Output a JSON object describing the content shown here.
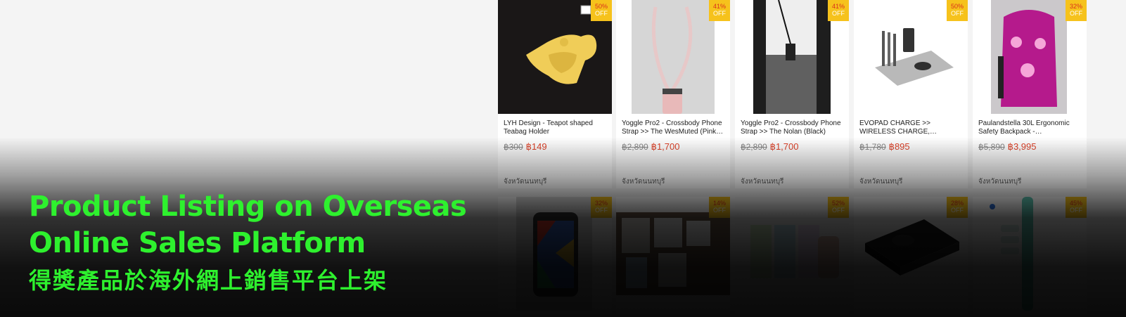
{
  "banner": {
    "headline_line1": "Product Listing on Overseas",
    "headline_line2": "Online Sales Platform",
    "subheadline": "得獎產品於海外網上銷售平台上架",
    "accent_color": "#2ef12e"
  },
  "listing": {
    "discount_off_label": "OFF",
    "row1": [
      {
        "discount": "50%",
        "title": "LYH Design - Teapot shaped Teabag Holder",
        "old_price": "฿300",
        "new_price": "฿149",
        "location": "จังหวัดนนทบุรี",
        "icon": "teapot-teabag-holder-image"
      },
      {
        "discount": "41%",
        "title": "Yoggle Pro2 - Crossbody Phone Strap >> The WesMuted (Pink…",
        "old_price": "฿2,890",
        "new_price": "฿1,700",
        "location": "จังหวัดนนทบุรี",
        "icon": "phone-strap-image"
      },
      {
        "discount": "41%",
        "title": "Yoggle Pro2 - Crossbody Phone Strap >> The Nolan (Black)",
        "old_price": "฿2,890",
        "new_price": "฿1,700",
        "location": "จังหวัดนนทบุรี",
        "icon": "person-phone-strap-image"
      },
      {
        "discount": "50%",
        "title": "EVOPAD CHARGE >> WIRELESS CHARGE,…",
        "old_price": "฿1,780",
        "new_price": "฿895",
        "location": "จังหวัดนนทบุรี",
        "icon": "charging-desk-pad-image"
      },
      {
        "discount": "32%",
        "title": "Paulandstella 30L Ergonomic Safety Backpack -…",
        "old_price": "฿5,890",
        "new_price": "฿3,995",
        "location": "จังหวัดนนทบุรี",
        "icon": "pink-backpack-image"
      }
    ],
    "row2": [
      {
        "discount": "32%",
        "icon": "patterned-backpack-image"
      },
      {
        "discount": "14%",
        "icon": "stationery-set-image"
      },
      {
        "discount": "52%",
        "icon": "pastel-boxes-image"
      },
      {
        "discount": "28%",
        "icon": "wireless-charger-image"
      },
      {
        "discount": "45%",
        "icon": "teal-tool-image"
      }
    ],
    "colors": {
      "badge": "#f6c21c",
      "price": "#e0432a"
    }
  }
}
